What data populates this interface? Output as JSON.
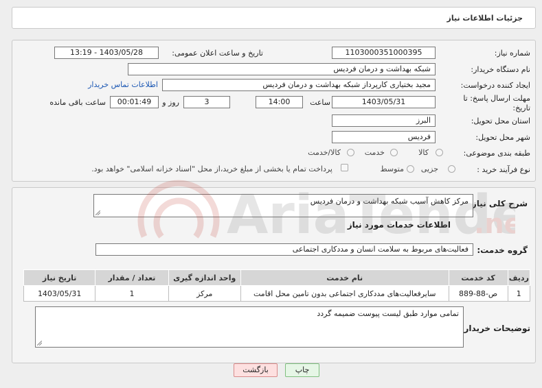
{
  "header": {
    "title": "جزئیات اطلاعات نیاز"
  },
  "form": {
    "need_number_label": "شماره نیاز:",
    "need_number": "1103000351000395",
    "announce_label": "تاریخ و ساعت اعلان عمومی:",
    "announce_value": "1403/05/28 - 13:19",
    "buyer_org_label": "نام دستگاه خریدار:",
    "buyer_org": "شبکه بهداشت و درمان فردیس",
    "creator_label": "ایجاد کننده درخواست:",
    "creator": "مجید بختیاری کارپرداز شبکه بهداشت و درمان فردیس",
    "contact_link": "اطلاعات تماس خریدار",
    "deadline_label_line1": "مهلت ارسال پاسخ: تا",
    "deadline_label_line2": "تاریخ:",
    "deadline_date": "1403/05/31",
    "time_label": "ساعت",
    "deadline_time": "14:00",
    "days_value": "3",
    "days_label": "روز و",
    "remaining_time": "00:01:49",
    "remaining_label": "ساعت باقی مانده",
    "province_label": "استان محل تحویل:",
    "province": "البرز",
    "city_label": "شهر محل تحویل:",
    "city": "فردیس",
    "category_label": "طبقه بندی موضوعی:",
    "category_options": [
      "کالا",
      "خدمت",
      "کالا/خدمت"
    ],
    "process_label": "نوع فرآیند خرید :",
    "process_options": [
      "جزیی",
      "متوسط"
    ],
    "payment_note": "پرداخت تمام یا بخشی از مبلغ خرید،از محل \"اسناد خزانه اسلامی\" خواهد بود."
  },
  "summary": {
    "label": "شرح کلی نیاز:",
    "value": "مرکز کاهش آسیب شبکه بهداشت و درمان فردیس"
  },
  "services": {
    "section_title": "اطلاعات خدمات مورد نیاز",
    "group_label": "گروه خدمت:",
    "group_value": "فعالیت‌های مربوط به سلامت انسان و مددکاری اجتماعی",
    "columns": [
      "ردیف",
      "کد خدمت",
      "نام خدمت",
      "واحد اندازه گیری",
      "تعداد / مقدار",
      "تاریخ نیاز"
    ],
    "rows": [
      [
        "1",
        "ص-88-889",
        "سایرفعالیت‌های مددکاری اجتماعی بدون تامین محل اقامت",
        "مرکز",
        "1",
        "1403/05/31"
      ]
    ]
  },
  "buyer_notes": {
    "label": "توضیحات خریدار:",
    "value": "تمامی موارد طبق لیست پیوست ضمیمه گردد"
  },
  "buttons": {
    "print": "چاپ",
    "back": "بازگشت"
  },
  "colors": {
    "link": "#1b57b3",
    "back_button_bg": "#fde0e0",
    "print_button_bg": "#e6f6e6"
  }
}
